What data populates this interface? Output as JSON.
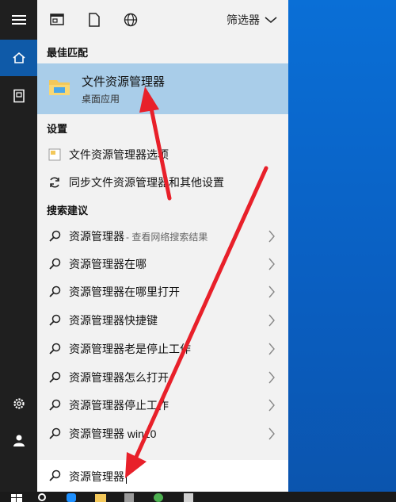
{
  "topbar": {
    "filter_label": "筛选器"
  },
  "sections": {
    "best": "最佳匹配",
    "settings": "设置",
    "suggestions": "搜索建议"
  },
  "best_match": {
    "title": "文件资源管理器",
    "subtitle": "桌面应用"
  },
  "settings_items": [
    {
      "label": "文件资源管理器选项"
    },
    {
      "label": "同步文件资源管理器和其他设置"
    }
  ],
  "suggestions": [
    {
      "label": "资源管理器",
      "hint": " - 查看网络搜索结果"
    },
    {
      "label": "资源管理器在哪"
    },
    {
      "label": "资源管理器在哪里打开"
    },
    {
      "label": "资源管理器快捷键"
    },
    {
      "label": "资源管理器老是停止工作"
    },
    {
      "label": "资源管理器怎么打开"
    },
    {
      "label": "资源管理器停止工作"
    },
    {
      "label": "资源管理器 win10"
    }
  ],
  "search": {
    "query": "资源管理器"
  },
  "colors": {
    "accent": "#0f5aa8",
    "highlight": "#a9cde9",
    "arrow": "#e8202a"
  },
  "icons": [
    "menu-icon",
    "home-icon",
    "document-icon",
    "settings-icon",
    "user-icon",
    "search-icon",
    "chevron-right-icon",
    "chevron-down-icon",
    "globe-icon",
    "folder-icon",
    "sync-icon"
  ]
}
